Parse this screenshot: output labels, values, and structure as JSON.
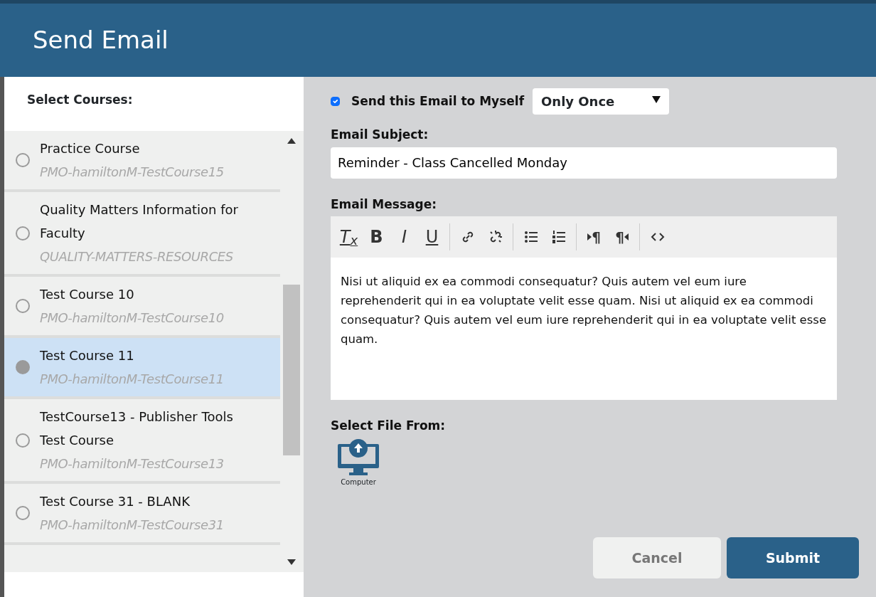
{
  "window": {
    "title": "Send Email"
  },
  "courses": {
    "label": "Select Courses:",
    "items": [
      {
        "title": "Practice Course",
        "code": "PMO-hamiltonM-TestCourse15",
        "selected": false
      },
      {
        "title": "Quality Matters Information for Faculty",
        "code": "QUALITY-MATTERS-RESOURCES",
        "selected": false
      },
      {
        "title": "Test Course 10",
        "code": "PMO-hamiltonM-TestCourse10",
        "selected": false
      },
      {
        "title": "Test Course 11",
        "code": "PMO-hamiltonM-TestCourse11",
        "selected": true
      },
      {
        "title": "TestCourse13 - Publisher Tools Test Course",
        "code": "PMO-hamiltonM-TestCourse13",
        "selected": false
      },
      {
        "title": "Test Course 31 - BLANK",
        "code": "PMO-hamiltonM-TestCourse31",
        "selected": false
      }
    ]
  },
  "send_to_myself": {
    "label": "Send this Email to Myself",
    "checked": true,
    "frequency": "Only Once"
  },
  "subject": {
    "label": "Email Subject:",
    "value": "Reminder - Class Cancelled Monday"
  },
  "message": {
    "label": "Email Message:",
    "toolbar": [
      {
        "kind": "clear",
        "label": "T$_{x}$"
      },
      {
        "kind": "bold",
        "label": "B"
      },
      {
        "kind": "italic",
        "label": "I"
      },
      {
        "kind": "underline",
        "label": "U"
      },
      {
        "kind": "sep"
      },
      {
        "kind": "link"
      },
      {
        "kind": "unlink"
      },
      {
        "kind": "sep"
      },
      {
        "kind": "bullets"
      },
      {
        "kind": "numbers"
      },
      {
        "kind": "sep"
      },
      {
        "kind": "ltr",
        "label": "¶"
      },
      {
        "kind": "rtl",
        "label": "¶"
      },
      {
        "kind": "sep"
      },
      {
        "kind": "source"
      }
    ],
    "body": "Nisi ut aliquid ex ea commodi consequatur? Quis autem vel eum iure reprehenderit qui in ea voluptate velit esse quam. Nisi ut aliquid ex ea commodi consequatur? Quis autem vel eum iure reprehenderit qui in ea voluptate velit esse quam."
  },
  "file_source": {
    "label": "Select File From:",
    "options": [
      {
        "label": "Computer"
      }
    ]
  },
  "buttons": [
    {
      "label": "Cancel",
      "kind": "secondary"
    },
    {
      "label": "Submit",
      "kind": "primary"
    }
  ]
}
